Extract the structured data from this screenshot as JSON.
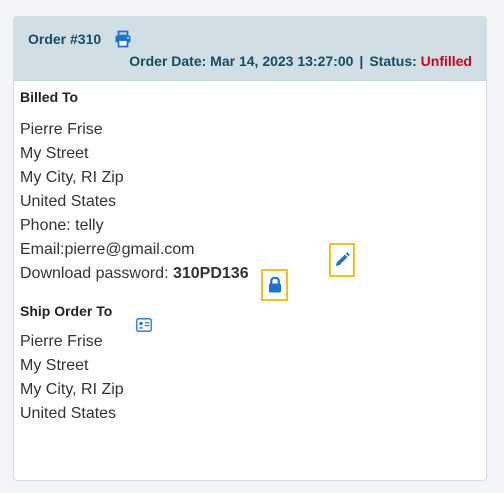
{
  "header": {
    "order_title": "Order #310",
    "order_date_label": "Order Date: Mar 14, 2023 13:27:00",
    "separator": "|",
    "status_label": "Status:",
    "status_value": "Unfilled",
    "icons": {
      "print": "printer-icon"
    }
  },
  "billed_to": {
    "title": "Billed To",
    "name": "Pierre Frise",
    "street": "My Street",
    "city": "My City, RI Zip",
    "country": "United States",
    "phone": "Phone: telly",
    "email_label": "Email:",
    "email_value": "pierre@gmail.com",
    "password_label": "Download password:",
    "password_value": "310PD136",
    "icons": {
      "edit": "pencil-icon",
      "lock": "lock-icon"
    }
  },
  "ship_to": {
    "title": "Ship Order To",
    "name": "Pierre Frise",
    "street": "My Street",
    "city": "My City, RI Zip",
    "country": "United States",
    "icons": {
      "contact": "contact-card-icon"
    }
  },
  "colors": {
    "header_bg": "#d1dfe5",
    "header_text": "#174b66",
    "status_unfilled": "#d0021b",
    "icon_blue": "#1a73d9",
    "highlight_border": "#f0c419"
  }
}
